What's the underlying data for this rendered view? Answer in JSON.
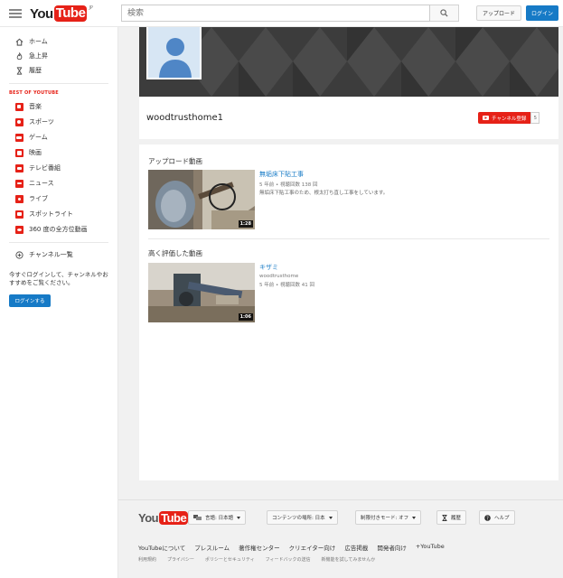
{
  "masthead": {
    "logo_you": "You",
    "logo_tube": "Tube",
    "logo_region": "JP",
    "search_placeholder": "検索",
    "upload_label": "アップロード",
    "login_label": "ログイン"
  },
  "sidebar": {
    "main_items": [
      {
        "label": "ホーム",
        "icon": "home-icon"
      },
      {
        "label": "急上昇",
        "icon": "flame-icon"
      },
      {
        "label": "履歴",
        "icon": "hourglass-icon"
      }
    ],
    "best_of_heading": "BEST OF YOUTUBE",
    "category_items": [
      {
        "label": "音楽",
        "icon": "music-icon"
      },
      {
        "label": "スポーツ",
        "icon": "sports-icon"
      },
      {
        "label": "ゲーム",
        "icon": "gaming-icon"
      },
      {
        "label": "映画",
        "icon": "movies-icon"
      },
      {
        "label": "テレビ番組",
        "icon": "tv-icon"
      },
      {
        "label": "ニュース",
        "icon": "news-icon"
      },
      {
        "label": "ライブ",
        "icon": "live-icon"
      },
      {
        "label": "スポットライト",
        "icon": "spotlight-icon"
      },
      {
        "label": "360 度の全方位動画",
        "icon": "360-video-icon"
      }
    ],
    "channel_list_label": "チャンネル一覧",
    "login_message": "今すぐログインして、チャンネルやおすすめをご覧ください。",
    "login_button": "ログインする"
  },
  "channel": {
    "name": "woodtrusthome1",
    "subscribe_label": "チャンネル登録",
    "subscriber_count": "5"
  },
  "sections": [
    {
      "title": "アップロード動画",
      "videos": [
        {
          "title": "無垢床下貼工事",
          "meta": "5 年前 • 視聴回数 138 回",
          "description": "無垢床下貼工事のため、根太打ち直し工事をしています。",
          "duration": "1:28"
        }
      ]
    },
    {
      "title": "高く評価した動画",
      "videos": [
        {
          "title": "キザミ",
          "channel": "woodtrusthome",
          "meta": "5 年前 • 視聴回数 41 回",
          "duration": "1:06"
        }
      ]
    }
  ],
  "footer": {
    "logo_you": "You",
    "logo_tube": "Tube",
    "language_label": "言語: 日本語",
    "location_label": "コンテンツの場所: 日本",
    "restricted_label": "制限付きモード: オフ",
    "history_label": "履歴",
    "help_label": "ヘルプ",
    "links": [
      "YouTubeについて",
      "プレスルーム",
      "著作権センター",
      "クリエイター向け",
      "広告掲載",
      "開発者向け",
      "+YouTube"
    ],
    "sublinks": [
      "利用規約",
      "プライバシー",
      "ポリシーとセキュリティ",
      "フィードバックの送信",
      "新機能を試してみませんか"
    ]
  },
  "colors": {
    "brand_red": "#e62117",
    "link_blue": "#167ac6",
    "background": "#f1f1f1"
  }
}
